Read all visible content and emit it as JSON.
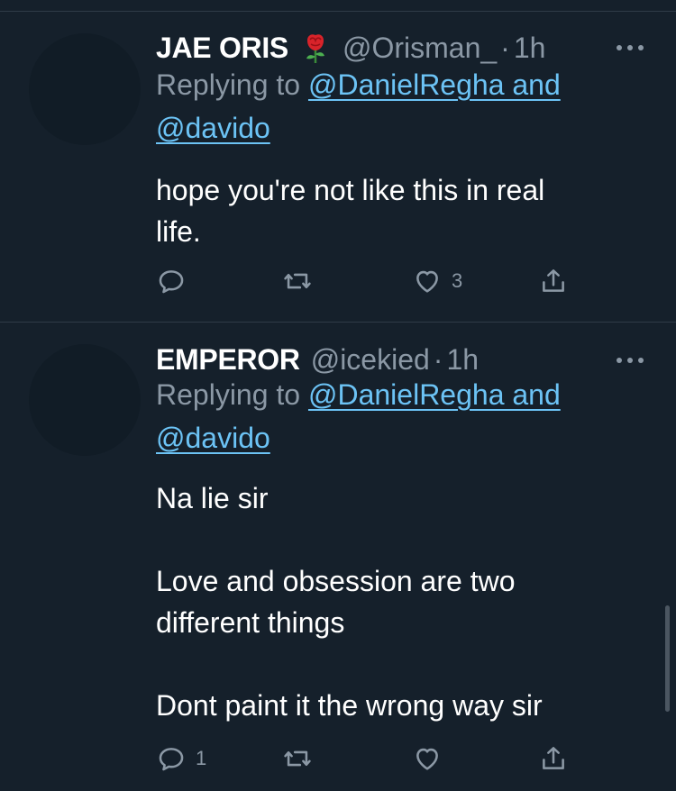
{
  "tweets": [
    {
      "display_name": "JAE ORIS",
      "emoji": "rose-emoji",
      "handle": "@Orisman_",
      "separator": "·",
      "time": "1h",
      "replying_prefix": "Replying to ",
      "mention_1": "@DanielRegha and",
      "mention_2": "@davido",
      "text": "hope you're not like this in real\nlife.",
      "reply_count": "",
      "retweet_count": "",
      "like_count": "3"
    },
    {
      "display_name": "EMPEROR",
      "handle": "@icekied",
      "separator": "·",
      "time": "1h",
      "replying_prefix": "Replying to ",
      "mention_1": "@DanielRegha and",
      "mention_2": "@davido",
      "text": "Na lie sir\n\nLove and obsession are two\ndifferent things\n\nDont paint it the wrong way sir",
      "reply_count": "1",
      "retweet_count": "",
      "like_count": ""
    }
  ],
  "icons": {
    "reply": "reply-icon",
    "retweet": "retweet-icon",
    "like": "heart-icon",
    "share": "share-icon",
    "more": "more-icon"
  },
  "colors": {
    "background": "#15202b",
    "secondary_text": "#8b98a5",
    "link": "#6cc3f5",
    "divider": "#2f3b48"
  }
}
